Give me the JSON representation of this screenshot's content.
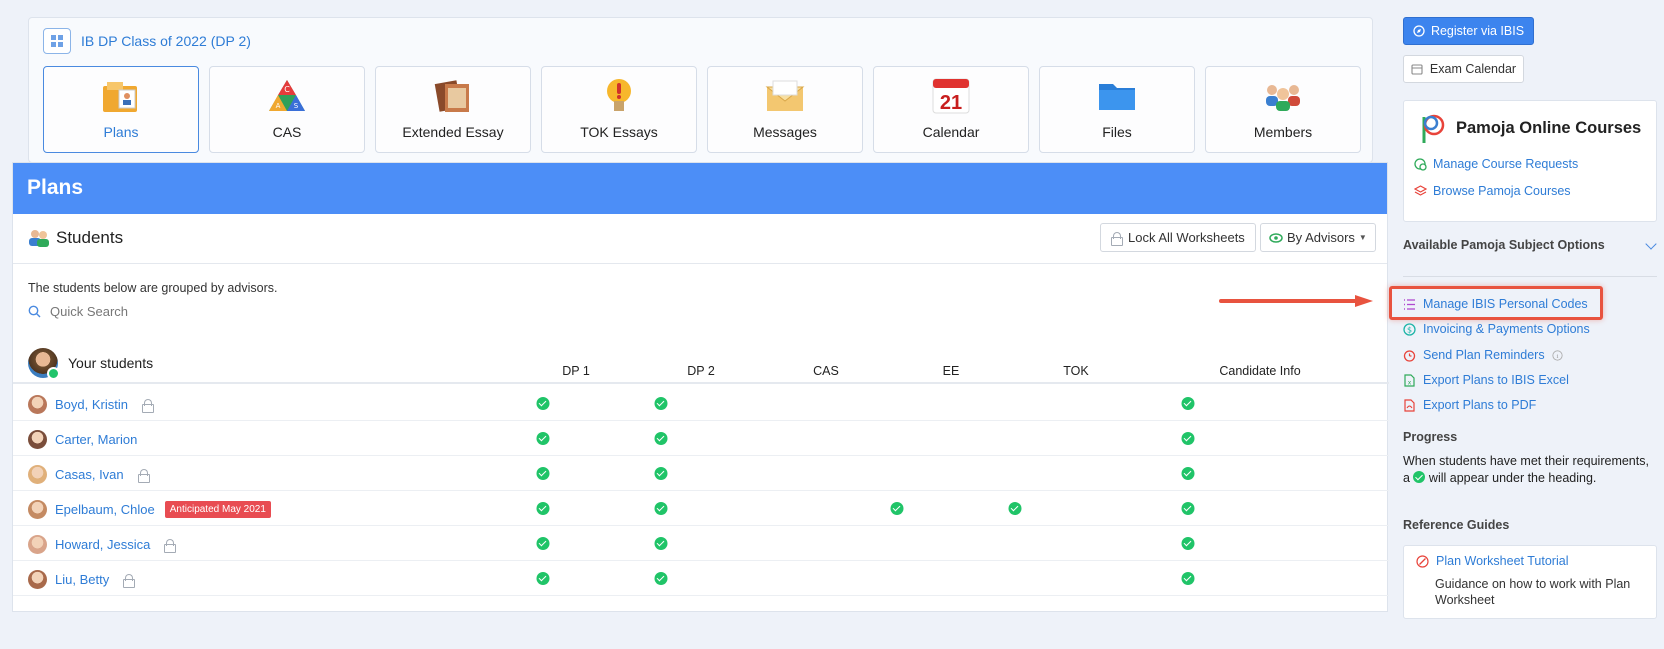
{
  "class_title": "IB DP Class of 2022 (DP 2)",
  "tiles": [
    {
      "label": "Plans",
      "icon": "plans-icon",
      "active": true
    },
    {
      "label": "CAS",
      "icon": "cas-icon"
    },
    {
      "label": "Extended Essay",
      "icon": "extended-essay-icon"
    },
    {
      "label": "TOK Essays",
      "icon": "lightbulb-icon"
    },
    {
      "label": "Messages",
      "icon": "envelope-icon"
    },
    {
      "label": "Calendar",
      "icon": "calendar-icon",
      "day": "21"
    },
    {
      "label": "Files",
      "icon": "folder-icon"
    },
    {
      "label": "Members",
      "icon": "members-icon"
    }
  ],
  "plans": {
    "title": "Plans",
    "students_title": "Students",
    "lock_all_label": "Lock All Worksheets",
    "by_advisors_label": "By Advisors",
    "grouped_note": "The students below are grouped by advisors.",
    "search_placeholder": "Quick Search",
    "your_students": "Your students",
    "columns": [
      "DP 1",
      "DP 2",
      "CAS",
      "EE",
      "TOK",
      "Candidate Info"
    ],
    "rows": [
      {
        "name": "Boyd, Kristin",
        "locked": true,
        "checks": [
          true,
          true,
          false,
          false,
          false,
          true
        ]
      },
      {
        "name": "Carter, Marion",
        "locked": false,
        "checks": [
          true,
          true,
          false,
          false,
          false,
          true
        ]
      },
      {
        "name": "Casas, Ivan",
        "locked": true,
        "checks": [
          true,
          true,
          false,
          false,
          false,
          true
        ]
      },
      {
        "name": "Epelbaum, Chloe",
        "locked": false,
        "badge": "Anticipated May 2021",
        "checks": [
          true,
          true,
          false,
          true,
          true,
          true
        ]
      },
      {
        "name": "Howard, Jessica",
        "locked": true,
        "checks": [
          true,
          true,
          false,
          false,
          false,
          true
        ]
      },
      {
        "name": "Liu, Betty",
        "locked": true,
        "checks": [
          true,
          true,
          false,
          false,
          false,
          true
        ]
      }
    ]
  },
  "sidebar": {
    "register_label": "Register via IBIS",
    "exam_calendar_label": "Exam Calendar",
    "pamoja_title": "Pamoja Online Courses",
    "manage_course_requests": "Manage Course Requests",
    "browse_pamoja": "Browse Pamoja Courses",
    "available_options": "Available Pamoja Subject Options",
    "links": [
      "Manage IBIS Personal Codes",
      "Invoicing & Payments Options",
      "Send Plan Reminders",
      "Export Plans to IBIS Excel",
      "Export Plans to PDF"
    ],
    "progress_heading": "Progress",
    "progress_text_a": "When students have met their requirements, a ",
    "progress_text_b": " will appear under the heading.",
    "reference_heading": "Reference Guides",
    "ref_link": "Plan Worksheet Tutorial",
    "ref_desc": "Guidance on how to work with Plan Worksheet"
  },
  "colors": {
    "accent": "#4c8ef7",
    "check": "#20c468",
    "highlight": "#e8533f",
    "badge": "#e84c52"
  }
}
